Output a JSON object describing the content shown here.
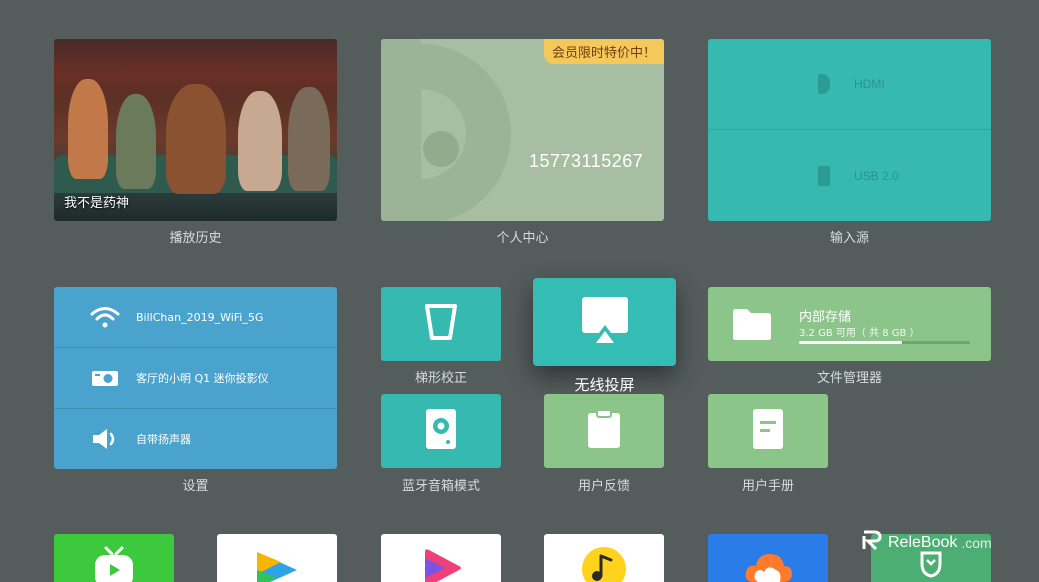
{
  "row1": {
    "history": {
      "movie_title": "我不是药神",
      "caption": "播放历史"
    },
    "personal": {
      "badge": "会员限时特价中！",
      "phone": "15773115267",
      "caption": "个人中心"
    },
    "input_source": {
      "items": [
        {
          "label": "HDMI"
        },
        {
          "label": "USB 2.0"
        }
      ],
      "caption": "输入源"
    }
  },
  "settings": {
    "items": [
      {
        "label": "BillChan_2019_WiFi_5G",
        "icon": "wifi-icon"
      },
      {
        "label": "客厅的小明 Q1 迷你投影仪",
        "icon": "projector-icon"
      },
      {
        "label": "自带扬声器",
        "icon": "speaker-icon"
      }
    ],
    "caption": "设置"
  },
  "tiles": {
    "keystone": {
      "caption": "梯形校正"
    },
    "cast": {
      "caption": "无线投屏"
    },
    "bluetooth": {
      "caption": "蓝牙音箱模式"
    },
    "feedback": {
      "caption": "用户反馈"
    },
    "manual": {
      "caption": "用户手册"
    }
  },
  "files": {
    "title": "内部存储",
    "subtitle": "3.2 GB 可用（ 共 8 GB ）",
    "used_fraction": 0.6,
    "caption": "文件管理器"
  },
  "watermark": {
    "brand": "ReleBook",
    "suffix": ".com"
  },
  "colors": {
    "background": "#555c5c",
    "teal": "#35b9b1",
    "green": "#8cc58a",
    "blue": "#4aa3cc",
    "badge": "#f3c95a"
  }
}
